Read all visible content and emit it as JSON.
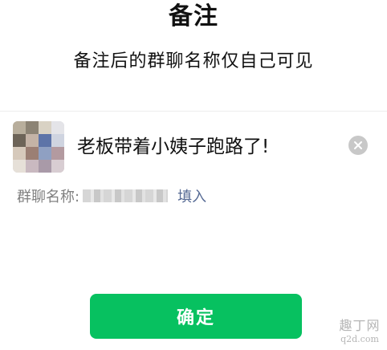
{
  "header": {
    "title": "备注",
    "subtitle": "备注后的群聊名称仅自己可见"
  },
  "remark": {
    "value": "老板带着小姨子跑路了!",
    "clear_icon": "clear-circle-icon"
  },
  "group_name": {
    "label": "群聊名称:",
    "fill_label": "填入"
  },
  "confirm": {
    "label": "确定"
  },
  "watermark": {
    "line1": "趣丁网",
    "line2": "q2d.com"
  },
  "colors": {
    "accent_green": "#07c160",
    "link_blue": "#576b95"
  }
}
